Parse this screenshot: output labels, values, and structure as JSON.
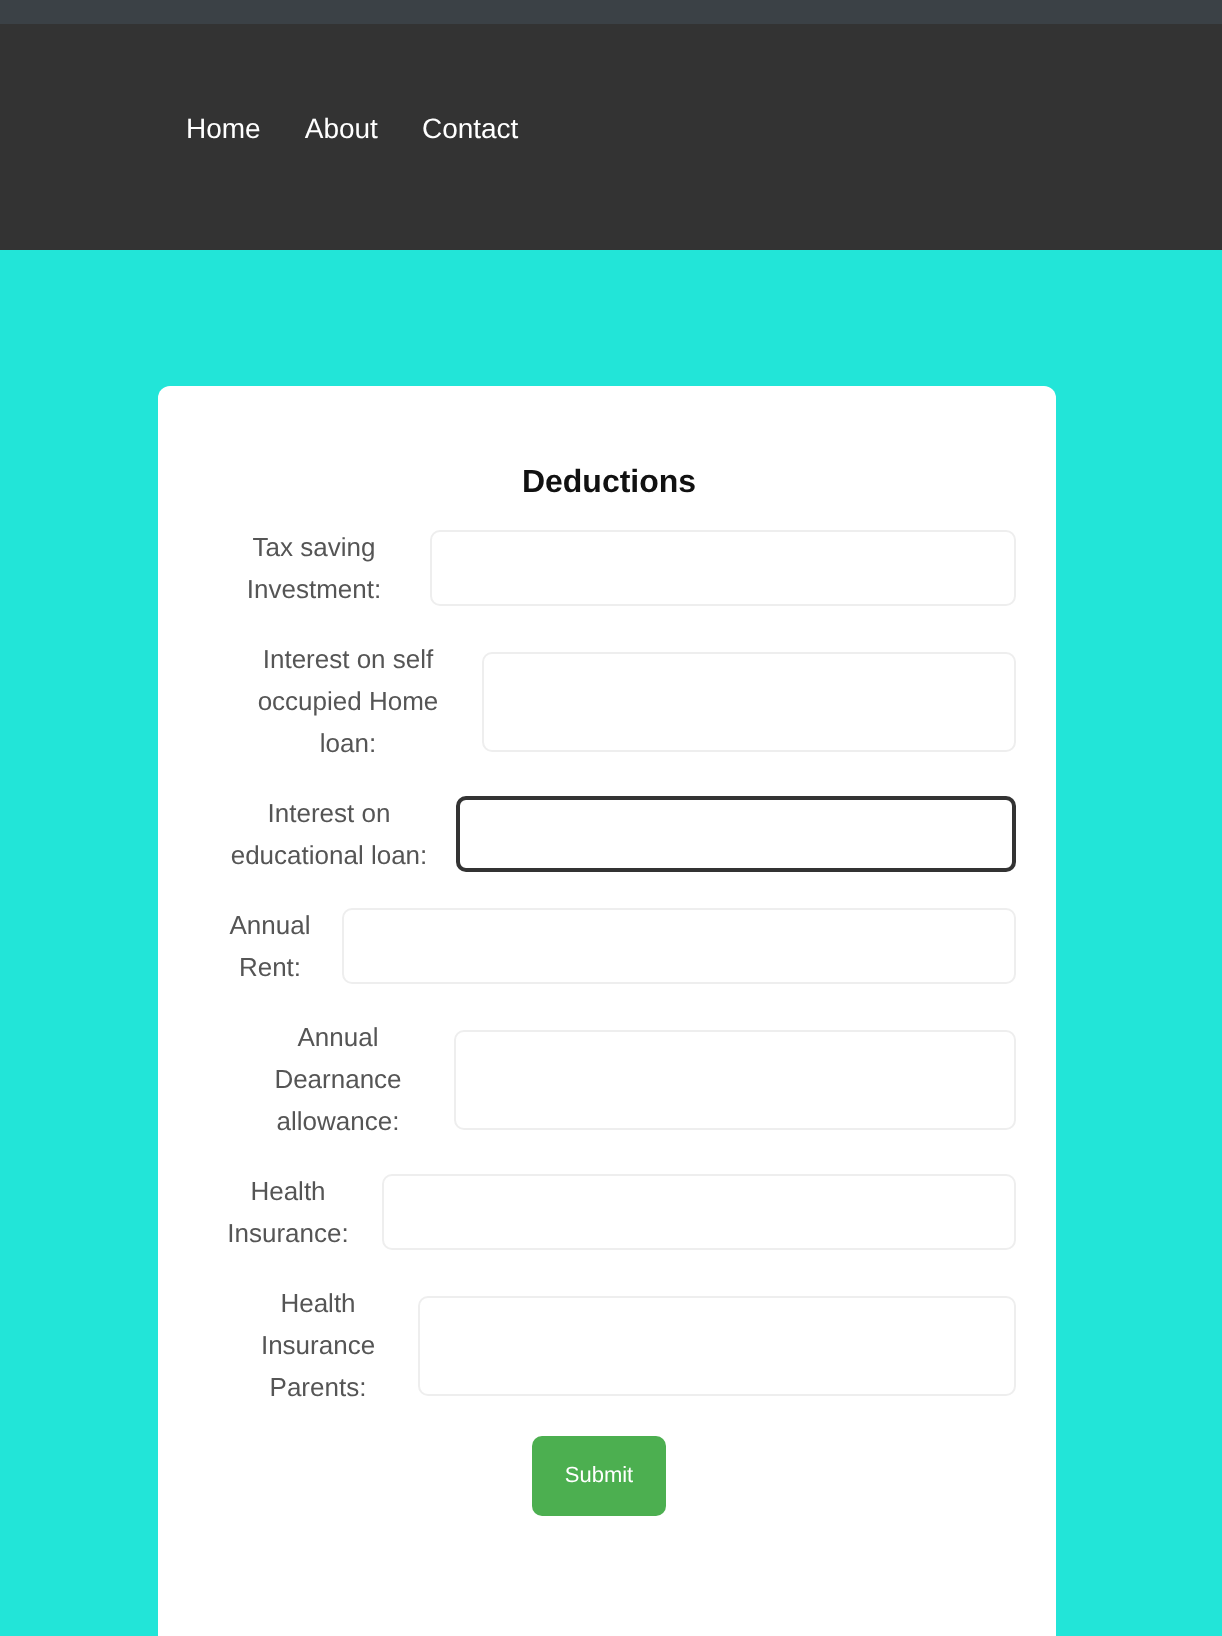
{
  "nav": {
    "links": [
      {
        "label": "Home"
      },
      {
        "label": "About"
      },
      {
        "label": "Contact"
      }
    ]
  },
  "form": {
    "title": "Deductions",
    "fields": [
      {
        "label": "Tax saving Investment:",
        "focused": false
      },
      {
        "label": "Interest on self occupied Home loan:",
        "focused": false
      },
      {
        "label": "Interest on educational loan:",
        "focused": true
      },
      {
        "label": "Annual Rent:",
        "focused": false
      },
      {
        "label": "Annual Dearnance allowance:",
        "focused": false
      },
      {
        "label": "Health Insurance:",
        "focused": false
      },
      {
        "label": "Health Insurance Parents:",
        "focused": false
      }
    ],
    "submit": "Submit"
  }
}
